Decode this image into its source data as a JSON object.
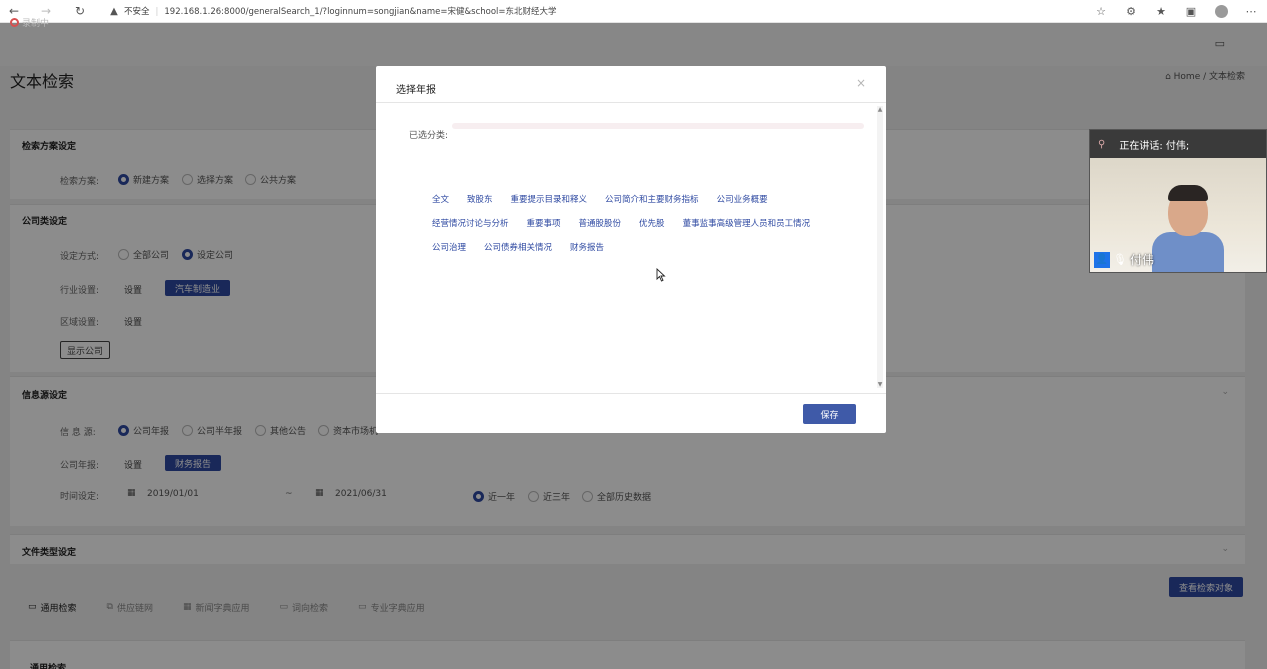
{
  "browser": {
    "insecure_label": "不安全",
    "url": "192.168.1.26:8000/generalSearch_1/?loginnum=songjian&name=宋健&school=东北财经大学"
  },
  "recording_badge": "录制中",
  "page": {
    "title": "文本检索",
    "breadcrumb": "Home / 文本检索",
    "scheme_panel": {
      "title": "检索方案设定",
      "label": "检索方案:",
      "options": [
        "新建方案",
        "选择方案",
        "公共方案"
      ]
    },
    "company_panel": {
      "title": "公司类设定",
      "method_label": "设定方式:",
      "method_options": [
        "全部公司",
        "设定公司"
      ],
      "industry_label": "行业设置:",
      "industry_set": "设置",
      "industry_value": "汽车制造业",
      "region_label": "区域设置:",
      "region_set": "设置",
      "show_companies": "显示公司"
    },
    "source_panel": {
      "title": "信息源设定",
      "source_label": "信 息 源:",
      "source_options": [
        "公司年报",
        "公司半年报",
        "其他公告",
        "资本市场机"
      ],
      "annual_label": "公司年报:",
      "annual_set": "设置",
      "annual_value": "财务报告",
      "time_label": "时间设定:",
      "date_start": "2019/01/01",
      "date_sep": "~",
      "date_end": "2021/06/31",
      "range_options": [
        "近一年",
        "近三年",
        "全部历史数据"
      ]
    },
    "filetype_panel": {
      "title": "文件类型设定"
    },
    "view_targets_button": "查看检索对象",
    "tabs": [
      "通用检索",
      "供应链网",
      "新闻字典应用",
      "词向检索",
      "专业字典应用"
    ],
    "section_heading": "通用检索"
  },
  "modal": {
    "title": "选择年报",
    "close": "×",
    "selected_label": "已选分类:",
    "categories": [
      [
        "全文",
        "致股东",
        "重要提示目录和释义",
        "公司简介和主要财务指标",
        "公司业务概要"
      ],
      [
        "经营情况讨论与分析",
        "重要事项",
        "普通股股份",
        "优先股",
        "董事监事高级管理人员和员工情况"
      ],
      [
        "公司治理",
        "公司债券相关情况",
        "财务报告"
      ]
    ],
    "save": "保存"
  },
  "video": {
    "speaking": "正在讲话: 付伟;",
    "name": "付伟"
  }
}
